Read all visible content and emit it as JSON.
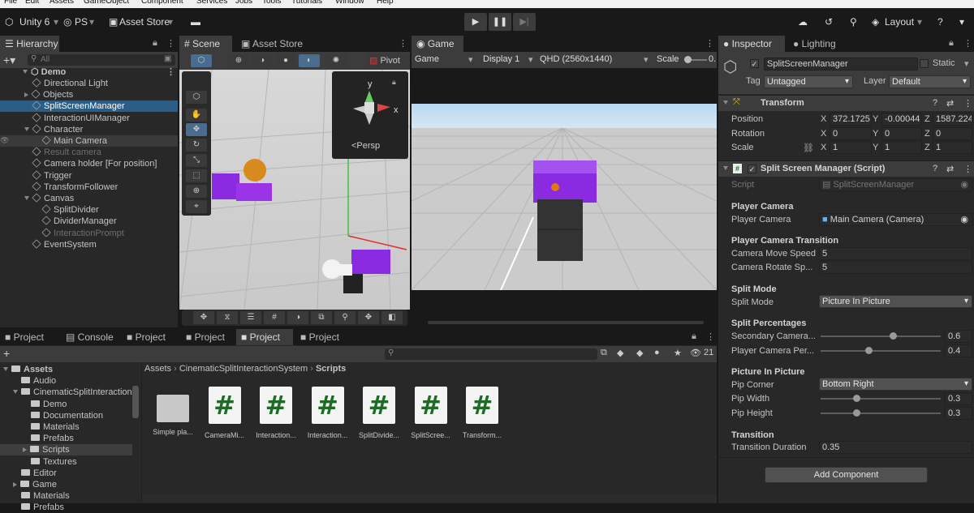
{
  "menu": [
    "File",
    "Edit",
    "Assets",
    "GameObject",
    "Component",
    "Services",
    "Jobs",
    "Tools",
    "Tutorials",
    "Window",
    "Help"
  ],
  "toolbar": {
    "unity_label": "Unity 6",
    "account": "PS",
    "asset_store": "Asset Store",
    "layout": "Layout",
    "play": "▶",
    "pause": "❚❚",
    "step": "▶|"
  },
  "hierarchy": {
    "tab": "Hierarchy",
    "search_placeholder": "All",
    "scene": "Demo",
    "items": [
      {
        "label": "Directional Light",
        "depth": 2,
        "arrow": "",
        "state": ""
      },
      {
        "label": "Objects",
        "depth": 2,
        "arrow": "right",
        "state": ""
      },
      {
        "label": "SplitScreenManager",
        "depth": 2,
        "arrow": "",
        "state": "sel"
      },
      {
        "label": "InteractionUIManager",
        "depth": 2,
        "arrow": "",
        "state": ""
      },
      {
        "label": "Character",
        "depth": 2,
        "arrow": "down",
        "state": ""
      },
      {
        "label": "Main Camera",
        "depth": 3,
        "arrow": "",
        "state": "hl"
      },
      {
        "label": "Result camera",
        "depth": 2,
        "arrow": "",
        "state": "dim"
      },
      {
        "label": "Camera holder [For position]",
        "depth": 2,
        "arrow": "",
        "state": ""
      },
      {
        "label": "Trigger",
        "depth": 2,
        "arrow": "",
        "state": ""
      },
      {
        "label": "TransformFollower",
        "depth": 2,
        "arrow": "",
        "state": ""
      },
      {
        "label": "Canvas",
        "depth": 2,
        "arrow": "down",
        "state": ""
      },
      {
        "label": "SplitDivider",
        "depth": 3,
        "arrow": "",
        "state": ""
      },
      {
        "label": "DividerManager",
        "depth": 3,
        "arrow": "",
        "state": ""
      },
      {
        "label": "InteractionPrompt",
        "depth": 3,
        "arrow": "",
        "state": "dim"
      },
      {
        "label": "EventSystem",
        "depth": 2,
        "arrow": "",
        "state": ""
      }
    ]
  },
  "scene": {
    "tab": "Scene",
    "tab2": "Asset Store",
    "pivot": "Pivot",
    "persp": "<Persp",
    "axis_y": "y",
    "axis_x": "x"
  },
  "game": {
    "tab": "Game",
    "mode": "Game",
    "display": "Display 1",
    "resolution": "QHD (2560x1440)",
    "scale_label": "Scale",
    "scale_value": "0."
  },
  "project": {
    "tabs": [
      "Project",
      "Console",
      "Project",
      "Project",
      "Project",
      "Project"
    ],
    "breadcrumb": [
      "Assets",
      "CinematicSplitInteractionSystem",
      "Scripts"
    ],
    "hidden_count": "21",
    "tree": [
      {
        "label": "Assets",
        "depth": 0,
        "arrow": "down",
        "bold": true
      },
      {
        "label": "Audio",
        "depth": 1,
        "arrow": ""
      },
      {
        "label": "CinematicSplitInteraction",
        "depth": 1,
        "arrow": "down"
      },
      {
        "label": "Demo",
        "depth": 2,
        "arrow": ""
      },
      {
        "label": "Documentation",
        "depth": 2,
        "arrow": ""
      },
      {
        "label": "Materials",
        "depth": 2,
        "arrow": ""
      },
      {
        "label": "Prefabs",
        "depth": 2,
        "arrow": ""
      },
      {
        "label": "Scripts",
        "depth": 2,
        "arrow": "right",
        "sel": true
      },
      {
        "label": "Textures",
        "depth": 2,
        "arrow": ""
      },
      {
        "label": "Editor",
        "depth": 1,
        "arrow": ""
      },
      {
        "label": "Game",
        "depth": 1,
        "arrow": "right"
      },
      {
        "label": "Materials",
        "depth": 1,
        "arrow": ""
      },
      {
        "label": "Prefabs",
        "depth": 1,
        "arrow": ""
      }
    ],
    "assets": [
      {
        "name": "Simple pla...",
        "type": "folder"
      },
      {
        "name": "CameraMi...",
        "type": "script"
      },
      {
        "name": "Interaction...",
        "type": "script"
      },
      {
        "name": "Interaction...",
        "type": "script"
      },
      {
        "name": "SplitDivide...",
        "type": "script"
      },
      {
        "name": "SplitScree...",
        "type": "script"
      },
      {
        "name": "Transform...",
        "type": "script"
      }
    ],
    "script_glyph": "#"
  },
  "inspector": {
    "tab": "Inspector",
    "tab2": "Lighting",
    "object_name": "SplitScreenManager",
    "static_label": "Static",
    "tag_label": "Tag",
    "tag_value": "Untagged",
    "layer_label": "Layer",
    "layer_value": "Default",
    "transform": {
      "title": "Transform",
      "position": {
        "label": "Position",
        "x": "372.1725",
        "y": "-0.00044",
        "z": "1587.224"
      },
      "rotation": {
        "label": "Rotation",
        "x": "0",
        "y": "0",
        "z": "0"
      },
      "scale": {
        "label": "Scale",
        "x": "1",
        "y": "1",
        "z": "1"
      }
    },
    "script_component": {
      "title": "Split Screen Manager (Script)",
      "script_label": "Script",
      "script_value": "SplitScreenManager",
      "player_camera_header": "Player Camera",
      "player_camera_label": "Player Camera",
      "player_camera_value": "Main Camera (Camera)",
      "transition_header": "Player Camera Transition",
      "move_speed_label": "Camera Move Speed",
      "move_speed_value": "5",
      "rotate_speed_label": "Camera Rotate Sp...",
      "rotate_speed_value": "5",
      "split_mode_header": "Split Mode",
      "split_mode_label": "Split Mode",
      "split_mode_value": "Picture In Picture",
      "split_pct_header": "Split Percentages",
      "secondary_label": "Secondary Camera...",
      "secondary_value": "0.6",
      "secondary_fraction": 0.6,
      "player_pct_label": "Player Camera Per...",
      "player_pct_value": "0.4",
      "player_pct_fraction": 0.4,
      "pip_header": "Picture In Picture",
      "pip_corner_label": "Pip Corner",
      "pip_corner_value": "Bottom Right",
      "pip_width_label": "Pip Width",
      "pip_width_value": "0.3",
      "pip_width_fraction": 0.3,
      "pip_height_label": "Pip Height",
      "pip_height_value": "0.3",
      "pip_height_fraction": 0.3,
      "transition2_header": "Transition",
      "duration_label": "Transition Duration",
      "duration_value": "0.35"
    },
    "add_component": "Add Component"
  },
  "colors": {
    "accent": "#2c5d87",
    "panel": "#282828",
    "dark": "#191919",
    "purple": "#8a2be2"
  }
}
